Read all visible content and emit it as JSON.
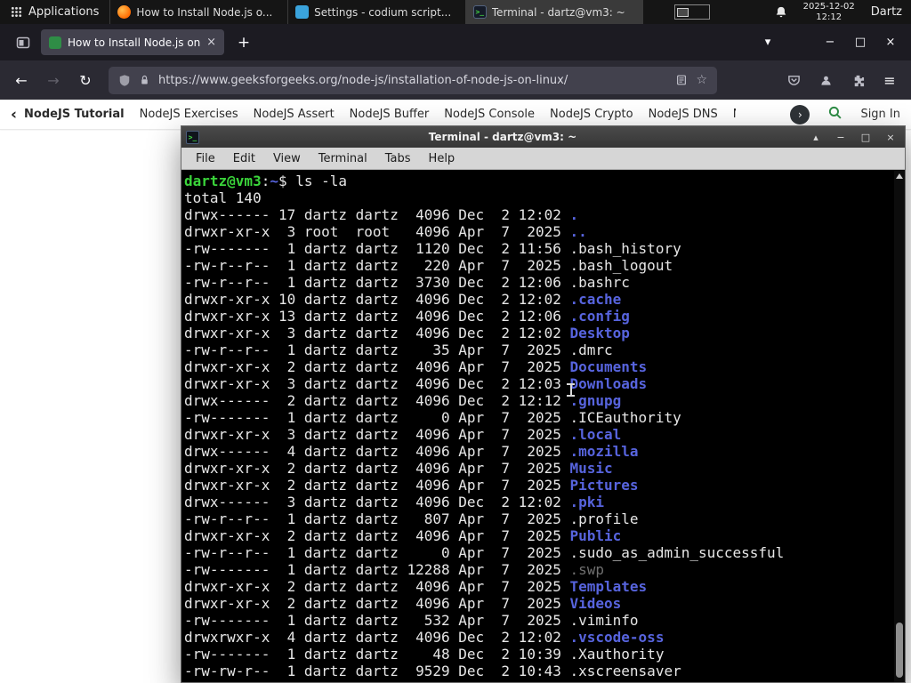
{
  "glyphs": {
    "back": "←",
    "forward": "→",
    "reload": "↻",
    "star": "☆",
    "menu": "≡",
    "new_tab": "+",
    "tab_list": "▾",
    "win_min": "−",
    "win_max": "□",
    "win_close": "×",
    "tab_close": "×",
    "term_shade": "▴",
    "term_min": "−",
    "term_max": "□",
    "term_close": "×",
    "chev_left": "‹",
    "chev_right": "›",
    "terminal_glyph": ">_"
  },
  "panel": {
    "applications_label": "Applications",
    "tasks": [
      {
        "title": "How to Install Node.js o...",
        "icon": "firefox",
        "active": false
      },
      {
        "title": "Settings - codium script...",
        "icon": "codium",
        "active": false
      },
      {
        "title": "Terminal - dartz@vm3: ~",
        "icon": "terminal",
        "active": true
      }
    ],
    "clock_date": "2025-12-02",
    "clock_time": "12:12",
    "user": "Dartz"
  },
  "browser": {
    "tab_title": "How to Install Node.js on",
    "url": "https://www.geeksforgeeks.org/node-js/installation-of-node-js-on-linux/"
  },
  "gfg_nav": {
    "items": [
      "NodeJS Tutorial",
      "NodeJS Exercises",
      "NodeJS Assert",
      "NodeJS Buffer",
      "NodeJS Console",
      "NodeJS Crypto",
      "NodeJS DNS",
      "Node"
    ],
    "sign_in": "Sign In"
  },
  "terminal": {
    "title": "Terminal - dartz@vm3: ~",
    "menu": [
      "File",
      "Edit",
      "View",
      "Terminal",
      "Tabs",
      "Help"
    ],
    "prompt": {
      "user_host": "dartz@vm3",
      "separator": ":",
      "path": "~",
      "symbol": "$ ",
      "command": "ls -la"
    },
    "total": "total 140",
    "listing": [
      {
        "meta": "drwx------ 17 dartz dartz  4096 Dec  2 12:02 ",
        "name": ".",
        "type": "dir"
      },
      {
        "meta": "drwxr-xr-x  3 root  root   4096 Apr  7  2025 ",
        "name": "..",
        "type": "dir"
      },
      {
        "meta": "-rw-------  1 dartz dartz  1120 Dec  2 11:56 ",
        "name": ".bash_history",
        "type": "file"
      },
      {
        "meta": "-rw-r--r--  1 dartz dartz   220 Apr  7  2025 ",
        "name": ".bash_logout",
        "type": "file"
      },
      {
        "meta": "-rw-r--r--  1 dartz dartz  3730 Dec  2 12:06 ",
        "name": ".bashrc",
        "type": "file"
      },
      {
        "meta": "drwxr-xr-x 10 dartz dartz  4096 Dec  2 12:02 ",
        "name": ".cache",
        "type": "dir"
      },
      {
        "meta": "drwxr-xr-x 13 dartz dartz  4096 Dec  2 12:06 ",
        "name": ".config",
        "type": "dir"
      },
      {
        "meta": "drwxr-xr-x  3 dartz dartz  4096 Dec  2 12:02 ",
        "name": "Desktop",
        "type": "dir"
      },
      {
        "meta": "-rw-r--r--  1 dartz dartz    35 Apr  7  2025 ",
        "name": ".dmrc",
        "type": "file"
      },
      {
        "meta": "drwxr-xr-x  2 dartz dartz  4096 Apr  7  2025 ",
        "name": "Documents",
        "type": "dir"
      },
      {
        "meta": "drwxr-xr-x  3 dartz dartz  4096 Dec  2 12:03 ",
        "name": "Downloads",
        "type": "dir"
      },
      {
        "meta": "drwx------  2 dartz dartz  4096 Dec  2 12:12 ",
        "name": ".gnupg",
        "type": "dir"
      },
      {
        "meta": "-rw-------  1 dartz dartz     0 Apr  7  2025 ",
        "name": ".ICEauthority",
        "type": "file"
      },
      {
        "meta": "drwxr-xr-x  3 dartz dartz  4096 Apr  7  2025 ",
        "name": ".local",
        "type": "dir"
      },
      {
        "meta": "drwx------  4 dartz dartz  4096 Apr  7  2025 ",
        "name": ".mozilla",
        "type": "dir"
      },
      {
        "meta": "drwxr-xr-x  2 dartz dartz  4096 Apr  7  2025 ",
        "name": "Music",
        "type": "dir"
      },
      {
        "meta": "drwxr-xr-x  2 dartz dartz  4096 Apr  7  2025 ",
        "name": "Pictures",
        "type": "dir"
      },
      {
        "meta": "drwx------  3 dartz dartz  4096 Dec  2 12:02 ",
        "name": ".pki",
        "type": "dir"
      },
      {
        "meta": "-rw-r--r--  1 dartz dartz   807 Apr  7  2025 ",
        "name": ".profile",
        "type": "file"
      },
      {
        "meta": "drwxr-xr-x  2 dartz dartz  4096 Apr  7  2025 ",
        "name": "Public",
        "type": "dir"
      },
      {
        "meta": "-rw-r--r--  1 dartz dartz     0 Apr  7  2025 ",
        "name": ".sudo_as_admin_successful",
        "type": "file"
      },
      {
        "meta": "-rw-------  1 dartz dartz 12288 Apr  7  2025 ",
        "name": ".swp",
        "type": "dim"
      },
      {
        "meta": "drwxr-xr-x  2 dartz dartz  4096 Apr  7  2025 ",
        "name": "Templates",
        "type": "dir"
      },
      {
        "meta": "drwxr-xr-x  2 dartz dartz  4096 Apr  7  2025 ",
        "name": "Videos",
        "type": "dir"
      },
      {
        "meta": "-rw-------  1 dartz dartz   532 Apr  7  2025 ",
        "name": ".viminfo",
        "type": "file"
      },
      {
        "meta": "drwxrwxr-x  4 dartz dartz  4096 Dec  2 12:02 ",
        "name": ".vscode-oss",
        "type": "dir"
      },
      {
        "meta": "-rw-------  1 dartz dartz    48 Dec  2 10:39 ",
        "name": ".Xauthority",
        "type": "file"
      },
      {
        "meta": "-rw-rw-r--  1 dartz dartz  9529 Dec  2 10:43 ",
        "name": ".xscreensaver",
        "type": "file"
      }
    ]
  },
  "colors": {
    "gfg_green": "#2f8d46",
    "dir_blue": "#5764de",
    "prompt_green": "#3ad43a",
    "panel_bg": "#151515",
    "terminal_bg": "#000000",
    "firefox_toolbar": "#2b2a33"
  }
}
